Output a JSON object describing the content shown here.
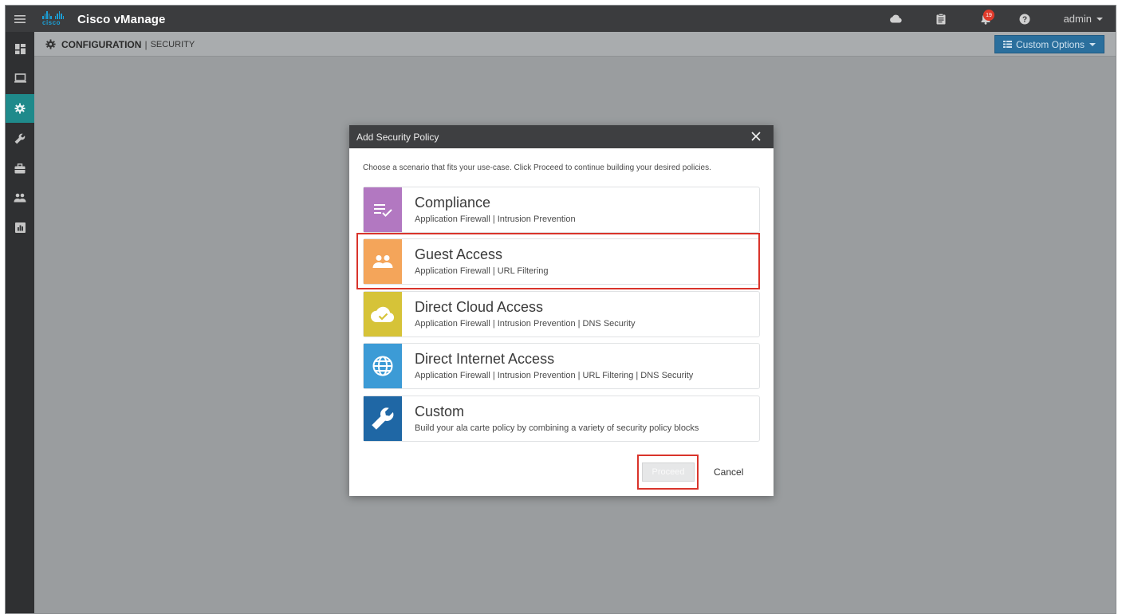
{
  "topbar": {
    "logo_word": "cisco",
    "app_title": "Cisco vManage",
    "notification_count": "19",
    "user": "admin"
  },
  "sidebar": {
    "items": [
      {
        "icon": "dashboard-icon"
      },
      {
        "icon": "monitor-icon"
      },
      {
        "icon": "gear-icon",
        "active": true
      },
      {
        "icon": "wrench-icon"
      },
      {
        "icon": "briefcase-icon"
      },
      {
        "icon": "users-icon"
      },
      {
        "icon": "analytics-icon"
      }
    ]
  },
  "breadcrumb": {
    "section": "CONFIGURATION",
    "separator": "|",
    "page": "SECURITY"
  },
  "custom_options": {
    "label": "Custom Options"
  },
  "modal": {
    "title": "Add Security Policy",
    "intro": "Choose a scenario that fits your use-case. Click Proceed to continue building your desired policies.",
    "options": [
      {
        "title": "Compliance",
        "subtitle": "Application Firewall | Intrusion Prevention",
        "color": "#b278c1",
        "icon": "list-check-icon"
      },
      {
        "title": "Guest Access",
        "subtitle": "Application Firewall | URL Filtering",
        "color": "#f4a55a",
        "icon": "users-icon",
        "highlighted": true
      },
      {
        "title": "Direct Cloud Access",
        "subtitle": "Application Firewall | Intrusion Prevention | DNS Security",
        "color": "#d6c338",
        "icon": "cloud-check-icon"
      },
      {
        "title": "Direct Internet Access",
        "subtitle": "Application Firewall | Intrusion Prevention | URL Filtering | DNS Security",
        "color": "#3c9bd6",
        "icon": "globe-icon"
      },
      {
        "title": "Custom",
        "subtitle": "Build your ala carte policy by combining a variety of security policy blocks",
        "color": "#1f67a5",
        "icon": "wrench-icon"
      }
    ],
    "proceed_label": "Proceed",
    "cancel_label": "Cancel"
  },
  "colors": {
    "highlight": "#d9342b",
    "accent_teal": "#1f8a8b",
    "button_blue": "#2a6f9d"
  }
}
